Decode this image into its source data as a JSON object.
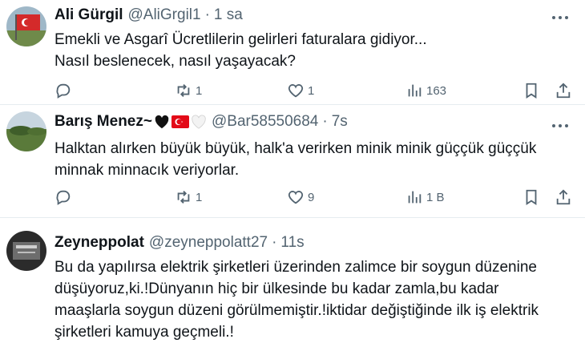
{
  "tweets": [
    {
      "name": "Ali Gürgil",
      "handle": "@AliGrgil1",
      "separator": "·",
      "time": "1 sa",
      "lines": [
        "Emekli ve Asgarî Ücretlilerin gelirleri faturalara gidiyor...",
        "Nasıl beslenecek, nasıl yaşayacak?"
      ],
      "replies": "",
      "retweets": "1",
      "likes": "1",
      "views": "163"
    },
    {
      "name": "Barış Menez~",
      "handle": "@Bar58550684",
      "separator": "·",
      "time": "7s",
      "lines": [
        "Halktan alırken büyük büyük, halk'a verirken minik minik güççük güççük",
        "minnak minnacık veriyorlar."
      ],
      "replies": "",
      "retweets": "1",
      "likes": "9",
      "views": "1 B"
    },
    {
      "name": "Zeyneppolat",
      "handle": "@zeyneppolatt27",
      "separator": "·",
      "time": "11s",
      "lines": [
        "Bu da yapılırsa elektrik şirketleri üzerinden zalimce bir soygun düzenine",
        "düşüyoruz,ki.!Dünyanın hiç bir ülkesinde bu kadar zamla,bu kadar",
        "maaşlarla soygun düzeni görülmemiştir.!iktidar değiştiğinde ilk iş elektrik",
        "şirketleri kamuya geçmeli.!"
      ]
    }
  ]
}
